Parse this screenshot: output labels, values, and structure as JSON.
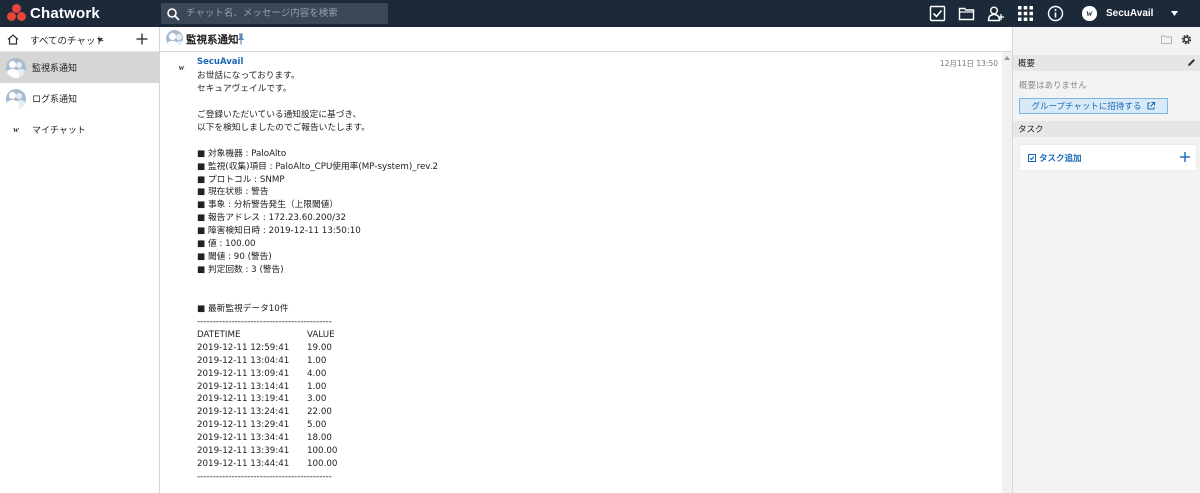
{
  "app": {
    "name": "Chatwork",
    "search_placeholder": "チャット名、メッセージ内容を検索",
    "user_name": "SecuAvail",
    "avatar_mark": "w",
    "brand_color": "#e8463d",
    "topbar_color": "#1c2939",
    "icons": [
      "task-icon",
      "file-icon",
      "contacts-icon",
      "apps-icon",
      "info-icon"
    ]
  },
  "sidebar": {
    "filter_label": "すべてのチャット",
    "rooms": [
      {
        "label": "監視系通知",
        "active": true
      },
      {
        "label": "ログ系通知",
        "active": false
      },
      {
        "label": "マイチャット",
        "active": false
      }
    ]
  },
  "room": {
    "title": "監視系通知"
  },
  "message": {
    "sender": "SecuAvail",
    "time": "12月11日 13:50",
    "lines": [
      "お世話になっております。",
      "セキュアヴェイルです。",
      "",
      "ご登録いただいている通知設定に基づき、",
      "以下を検知しましたのでご報告いたします。",
      "",
      "■ 対象機器 : PaloAlto",
      "■ 監視(収集)項目 : PaloAlto_CPU使用率(MP-system)_rev.2",
      "■ プロトコル : SNMP",
      "■ 現在状態 : 警告",
      "■ 事象 : 分析警告発生（上限閾値）",
      "■ 報告アドレス : 172.23.60.200/32",
      "■ 障害検知日時 : 2019-12-11 13:50:10",
      "■ 値 : 100.00",
      "■ 閾値 : 90 (警告)",
      "■ 判定回数 : 3 (警告)",
      "",
      "",
      "■ 最新監視データ10件",
      "-------------------------------------------"
    ],
    "data_header": [
      "DATETIME",
      "VALUE"
    ],
    "data_rows": [
      [
        "2019-12-11 12:59:41",
        "19.00"
      ],
      [
        "2019-12-11 13:04:41",
        "1.00"
      ],
      [
        "2019-12-11 13:09:41",
        "4.00"
      ],
      [
        "2019-12-11 13:14:41",
        "1.00"
      ],
      [
        "2019-12-11 13:19:41",
        "3.00"
      ],
      [
        "2019-12-11 13:24:41",
        "22.00"
      ],
      [
        "2019-12-11 13:29:41",
        "5.00"
      ],
      [
        "2019-12-11 13:34:41",
        "18.00"
      ],
      [
        "2019-12-11 13:39:41",
        "100.00"
      ],
      [
        "2019-12-11 13:44:41",
        "100.00"
      ]
    ],
    "footer_line": "-------------------------------------------"
  },
  "right_panel": {
    "summary_title": "概要",
    "summary_empty": "概要はありません",
    "invite_label": "グループチャットに招待する",
    "task_title": "タスク",
    "task_add_label": "タスク追加",
    "link_color": "#1a66b5"
  }
}
